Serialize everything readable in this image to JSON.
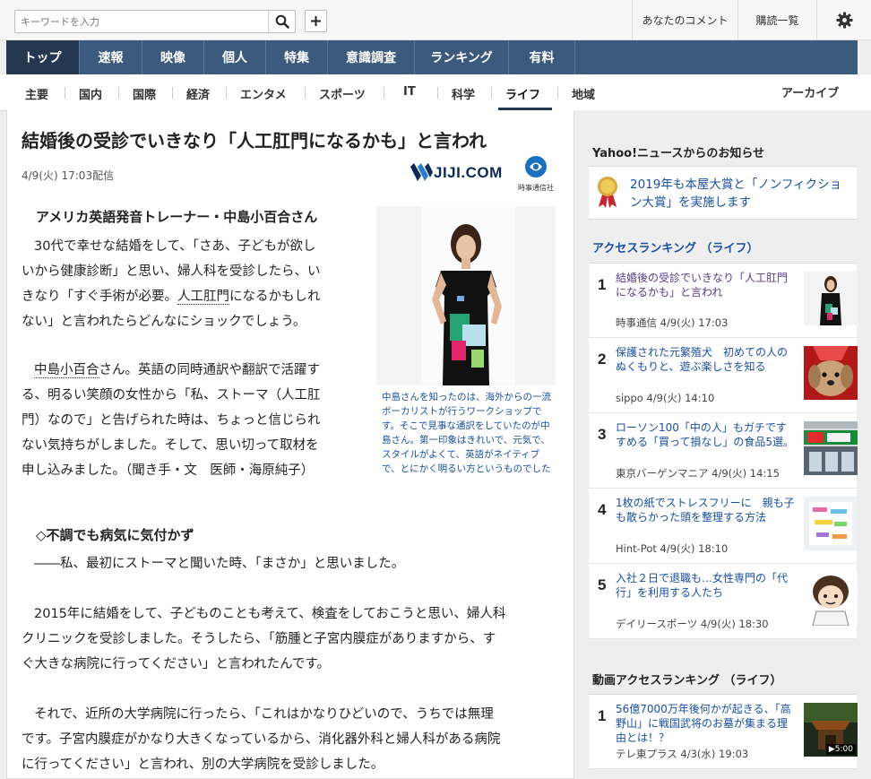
{
  "search": {
    "placeholder": "キーワードを入力"
  },
  "top_links": {
    "comments": "あなたのコメント",
    "subscriptions": "購読一覧"
  },
  "global_nav": [
    "トップ",
    "速報",
    "映像",
    "個人",
    "特集",
    "意識調査",
    "ランキング",
    "有料"
  ],
  "category_nav": [
    "主要",
    "国内",
    "国際",
    "経済",
    "エンタメ",
    "スポーツ",
    "IT",
    "科学",
    "ライフ",
    "地域"
  ],
  "archive_label": "アーカイブ",
  "article": {
    "headline": "結婚後の受診でいきなり「人工肛門になるかも」と言われ",
    "pubdate": "4/9(火) 17:03配信",
    "source_logo": "JIJI.COM",
    "source_logo_sub": "時事通信社",
    "byline": "アメリカ英語発音トレーナー・中島小百合さん",
    "p1_lines": [
      "30代で幸せな結婚をして、「さあ、子どもが欲し",
      "いから健康診断」と思い、婦人科を受診したら、い",
      "きなり「すぐ手術が必要。",
      "人工肛門",
      "になるかもしれ",
      "ない」と言われたらどんなにショックでしょう。"
    ],
    "p2_lines": [
      "中島小百合",
      "さん。英語の同時通訳や翻訳で活躍す",
      "る、明るい笑顔の女性から「私、ストーマ（人工肛",
      "門）なので」と告げられた時は、ちょっと信じられ",
      "ない気持ちがしました。そして、思い切って取材を",
      "申し込みました。（聞き手・文　医師・海原純子）"
    ],
    "caption": "中島さんを知ったのは、海外からの一流ボーカリストが行うワークショップです。そこで見事な通訳をしていたのが中島さん。第一印象はきれいで、元気で、スタイルがよくて、英語がネイティブで、とにかく明るい方というものでした",
    "subhead": "◇不調でも病気に気付かず",
    "p3": "――私、最初にストーマと聞いた時、「まさか」と思いました。",
    "p4_lines": [
      "2015年に結婚をして、子どものことも考えて、検査をしておこうと思い、婦人科",
      "クリニックを受診しました。そうしたら、「筋腫と子宮内膜症がありますから、す",
      "ぐ大きな病院に行ってください」と言われたんです。"
    ],
    "p5_lines": [
      "それで、近所の大学病院に行ったら、「これはかなりひどいので、うちでは無理",
      "です。子宮内膜症がかなり大きくなっているから、消化器外科と婦人科がある病院",
      "に行ってください」と言われ、別の大学病院を受診しました。"
    ]
  },
  "sidebar": {
    "notice_title": "Yahoo!ニュースからのお知らせ",
    "notice_text": "2019年も本屋大賞と「ノンフィクション大賞」を実施します",
    "ranking_title": "アクセスランキング （ライフ）",
    "ranking": [
      {
        "num": "1",
        "title": "結婚後の受診でいきなり「人工肛門になるかも」と言われ",
        "meta": "時事通信 4/9(火) 17:03"
      },
      {
        "num": "2",
        "title": "保護された元繁殖犬　初めての人のぬくもりと、遊ぶ楽しさを知る",
        "meta": "sippo 4/9(火) 14:10"
      },
      {
        "num": "3",
        "title": "ローソン100「中の人」もガチですすめる「買って損なし」の食品5選。",
        "meta": "東京バーゲンマニア 4/9(火) 14:15"
      },
      {
        "num": "4",
        "title": "1枚の紙でストレスフリーに　親も子も散らかった頭を整理する方法",
        "meta": "Hint-Pot 4/9(火) 18:10"
      },
      {
        "num": "5",
        "title": "入社２日で退職も…女性専門の「代行」を利用する人たち",
        "meta": "デイリースポーツ 4/9(火) 18:30"
      }
    ],
    "video_title": "動画アクセスランキング （ライフ）",
    "video_ranking": [
      {
        "num": "1",
        "title": "56億7000万年後何かが起きる、「高野山」に戦国武将のお墓が集まる理由とは！？",
        "meta": "テレ東プラス 4/3(水) 19:03",
        "duration": "▶5:00"
      }
    ]
  },
  "colors": {
    "nav_bg": "#3c5a7d",
    "nav_active": "#24384f",
    "link": "#1a4fa0"
  }
}
